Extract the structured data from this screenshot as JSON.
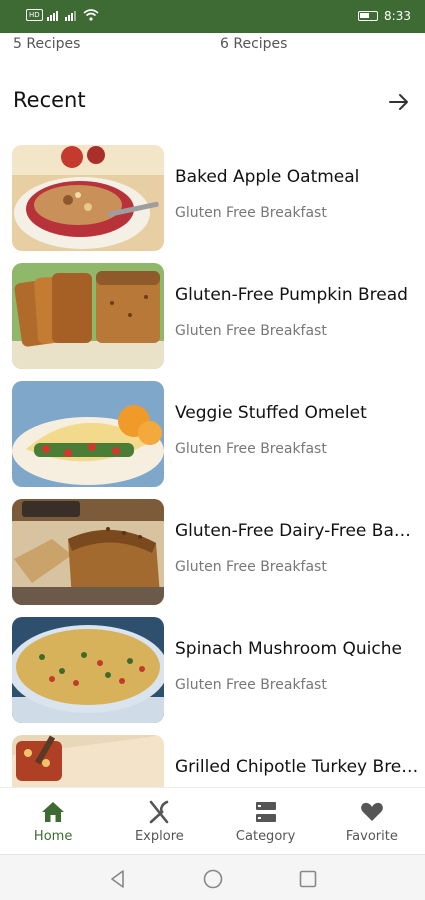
{
  "status_bar": {
    "sim_badge": "HD",
    "time": "8:33",
    "icons": [
      "sim-badge-icon",
      "signal-icon",
      "signal-icon",
      "wifi-icon",
      "battery-icon"
    ]
  },
  "recipe_counts": {
    "left": "5 Recipes",
    "right": "6 Recipes"
  },
  "recent": {
    "title": "Recent",
    "arrow_icon": "arrow-right-icon"
  },
  "recipes": [
    {
      "title": "Baked Apple Oatmeal",
      "subtitle": "Gluten Free Breakfast"
    },
    {
      "title": "Gluten-Free Pumpkin Bread",
      "subtitle": "Gluten Free Breakfast"
    },
    {
      "title": "Veggie Stuffed Omelet",
      "subtitle": "Gluten Free Breakfast"
    },
    {
      "title": "Gluten-Free Dairy-Free Banana Bread",
      "subtitle": "Gluten Free Breakfast"
    },
    {
      "title": "Spinach Mushroom Quiche",
      "subtitle": "Gluten Free Breakfast"
    },
    {
      "title": "Grilled Chipotle Turkey Breast",
      "subtitle": ""
    }
  ],
  "bottom_nav": {
    "items": [
      {
        "label": "Home",
        "icon": "home-icon",
        "active": true
      },
      {
        "label": "Explore",
        "icon": "fork-knife-icon",
        "active": false
      },
      {
        "label": "Category",
        "icon": "category-icon",
        "active": false
      },
      {
        "label": "Favorite",
        "icon": "heart-icon",
        "active": false
      }
    ]
  },
  "colors": {
    "brand_green": "#3e6b33",
    "inactive_icon": "#555555",
    "subtitle_text": "#777777"
  },
  "system_nav": {
    "icons": [
      "back-icon",
      "home-circle-icon",
      "recents-icon"
    ]
  }
}
